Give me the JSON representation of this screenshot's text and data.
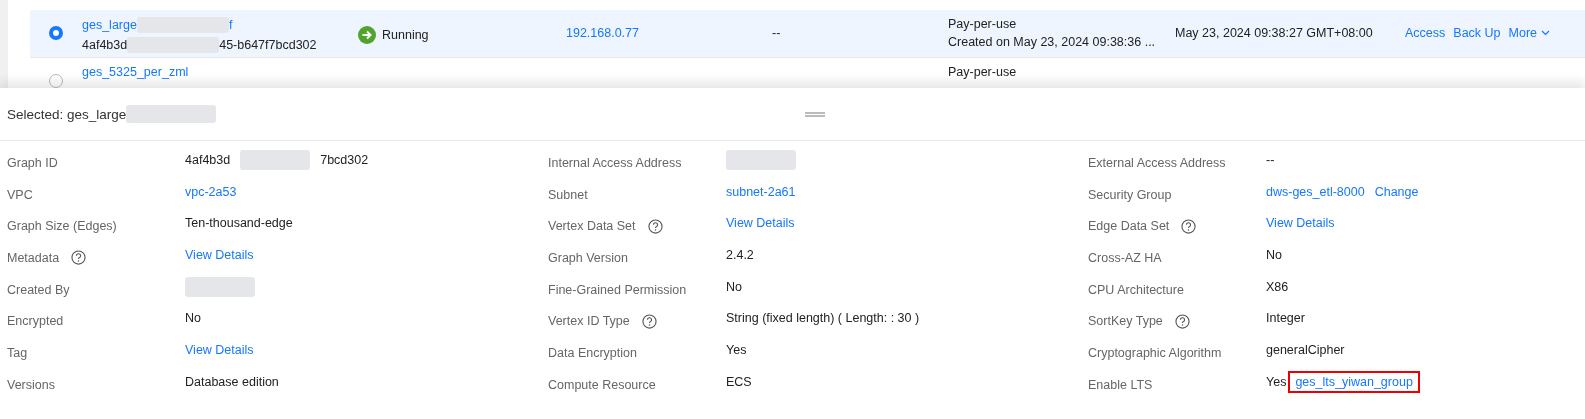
{
  "table": {
    "rows": [
      {
        "selected": true,
        "name": [
          {
            "kind": "link",
            "text": "ges_large"
          },
          {
            "kind": "redacted"
          },
          {
            "kind": "link",
            "text": "f"
          }
        ],
        "id": [
          {
            "kind": "text",
            "text": "4af4b3d"
          },
          {
            "kind": "redacted"
          },
          {
            "kind": "text",
            "text": "45-b647f7bcd302"
          }
        ],
        "status": "Running",
        "address": "192.168.0.77",
        "column_4": "--",
        "billing": [
          "Pay-per-use",
          "Created on May 23, 2024 09:38:36 ..."
        ],
        "created": "May 23, 2024 09:38:27 GMT+08:00",
        "actions": [
          "Access",
          "Back Up",
          "More"
        ]
      },
      {
        "selected": false,
        "name": [
          {
            "kind": "link",
            "text": "ges_5325_per_zml"
          }
        ],
        "id": [],
        "billing": [
          "Pay-per-use"
        ]
      }
    ]
  },
  "detail": {
    "selected_label": "Selected: ges_large",
    "fields": [
      {
        "label": "Graph ID",
        "help": false,
        "value": [
          {
            "kind": "text",
            "text": "4af4b3d"
          },
          {
            "kind": "redacted"
          },
          {
            "kind": "text",
            "text": "7bcd302"
          }
        ]
      },
      {
        "label": "Internal Access Address",
        "help": false,
        "value": [
          {
            "kind": "redacted"
          }
        ]
      },
      {
        "label": "External Access Address",
        "help": false,
        "value": [
          {
            "kind": "text",
            "text": "--"
          }
        ]
      },
      {
        "label": "VPC",
        "help": false,
        "value": [
          {
            "kind": "link",
            "text": "vpc-2a53"
          }
        ]
      },
      {
        "label": "Subnet",
        "help": false,
        "value": [
          {
            "kind": "link",
            "text": "subnet-2a61"
          }
        ]
      },
      {
        "label": "Security Group",
        "help": false,
        "value": [
          {
            "kind": "link",
            "text": "dws-ges_etl-8000"
          },
          {
            "kind": "link",
            "text": "Change"
          }
        ]
      },
      {
        "label": "Graph Size (Edges)",
        "help": false,
        "value": [
          {
            "kind": "text",
            "text": "Ten-thousand-edge"
          }
        ]
      },
      {
        "label": "Vertex Data Set",
        "help": true,
        "value": [
          {
            "kind": "link",
            "text": "View Details"
          }
        ]
      },
      {
        "label": "Edge Data Set",
        "help": true,
        "value": [
          {
            "kind": "link",
            "text": "View Details"
          }
        ]
      },
      {
        "label": "Metadata",
        "help": true,
        "value": [
          {
            "kind": "link",
            "text": "View Details"
          }
        ]
      },
      {
        "label": "Graph Version",
        "help": false,
        "value": [
          {
            "kind": "text",
            "text": "2.4.2"
          }
        ]
      },
      {
        "label": "Cross-AZ HA",
        "help": false,
        "value": [
          {
            "kind": "text",
            "text": "No"
          }
        ]
      },
      {
        "label": "Created By",
        "help": false,
        "value": [
          {
            "kind": "redacted"
          }
        ]
      },
      {
        "label": "Fine-Grained Permission",
        "help": false,
        "value": [
          {
            "kind": "text",
            "text": "No"
          }
        ]
      },
      {
        "label": "CPU Architecture",
        "help": false,
        "value": [
          {
            "kind": "text",
            "text": "X86"
          }
        ]
      },
      {
        "label": "Encrypted",
        "help": false,
        "value": [
          {
            "kind": "text",
            "text": "No"
          }
        ]
      },
      {
        "label": "Vertex ID Type",
        "help": true,
        "value": [
          {
            "kind": "text",
            "text": "String (fixed length) ( Length: : 30 )"
          }
        ]
      },
      {
        "label": "SortKey Type",
        "help": true,
        "value": [
          {
            "kind": "text",
            "text": "Integer"
          }
        ]
      },
      {
        "label": "Tag",
        "help": false,
        "value": [
          {
            "kind": "link",
            "text": "View Details"
          }
        ]
      },
      {
        "label": "Data Encryption",
        "help": false,
        "value": [
          {
            "kind": "text",
            "text": "Yes"
          }
        ]
      },
      {
        "label": "Cryptographic Algorithm",
        "help": false,
        "value": [
          {
            "kind": "text",
            "text": "generalCipher"
          }
        ]
      },
      {
        "label": "Versions",
        "help": false,
        "value": [
          {
            "kind": "text",
            "text": "Database edition"
          }
        ]
      },
      {
        "label": "Compute Resource",
        "help": false,
        "value": [
          {
            "kind": "text",
            "text": "ECS"
          }
        ]
      },
      {
        "label": "Enable LTS",
        "help": false,
        "value": [
          {
            "kind": "text",
            "text": "Yes"
          },
          {
            "kind": "link",
            "text": "ges_lts_yiwan_group",
            "highlighted": true
          }
        ]
      }
    ]
  }
}
